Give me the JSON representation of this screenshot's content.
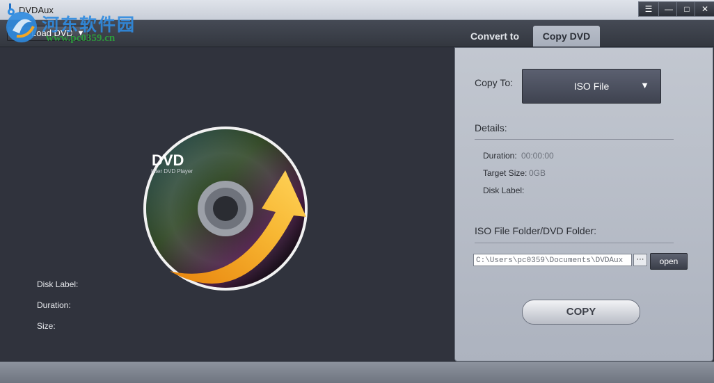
{
  "window": {
    "title": "DVDAux",
    "controls": [
      "☰",
      "—",
      "□",
      "✕"
    ]
  },
  "watermark": {
    "chinese": "河东软件园",
    "url": "www.pc0359.cn"
  },
  "toolbar": {
    "load_label": "Load DVD",
    "load_dropdown": "▼"
  },
  "tabs": [
    {
      "label": "Convert to",
      "active": false
    },
    {
      "label": "Copy DVD",
      "active": true
    }
  ],
  "disc": {
    "brand": "DVD",
    "subtitle": "Inter DVD Player"
  },
  "disk_info": {
    "disk_label": "Disk Label:",
    "duration": "Duration:",
    "size": "Size:"
  },
  "copy_panel": {
    "copy_to_label": "Copy To:",
    "copy_to_value": "ISO File",
    "copy_to_arrow": "▼",
    "details_label": "Details:",
    "duration_label": "Duration:",
    "duration_value": "00:00:00",
    "target_size_label": "Target Size:",
    "target_size_value": "0GB",
    "disk_label_label": "Disk Label:",
    "folder_label": "ISO File Folder/DVD Folder:",
    "folder_path": "C:\\Users\\pc0359\\Documents\\DVDAux",
    "browse_label": "···",
    "open_label": "open",
    "copy_button": "COPY"
  },
  "colors": {
    "accent_blue": "#2f8be0",
    "watermark_green": "#2d9a3c",
    "arrow_orange": "#f5a623"
  }
}
